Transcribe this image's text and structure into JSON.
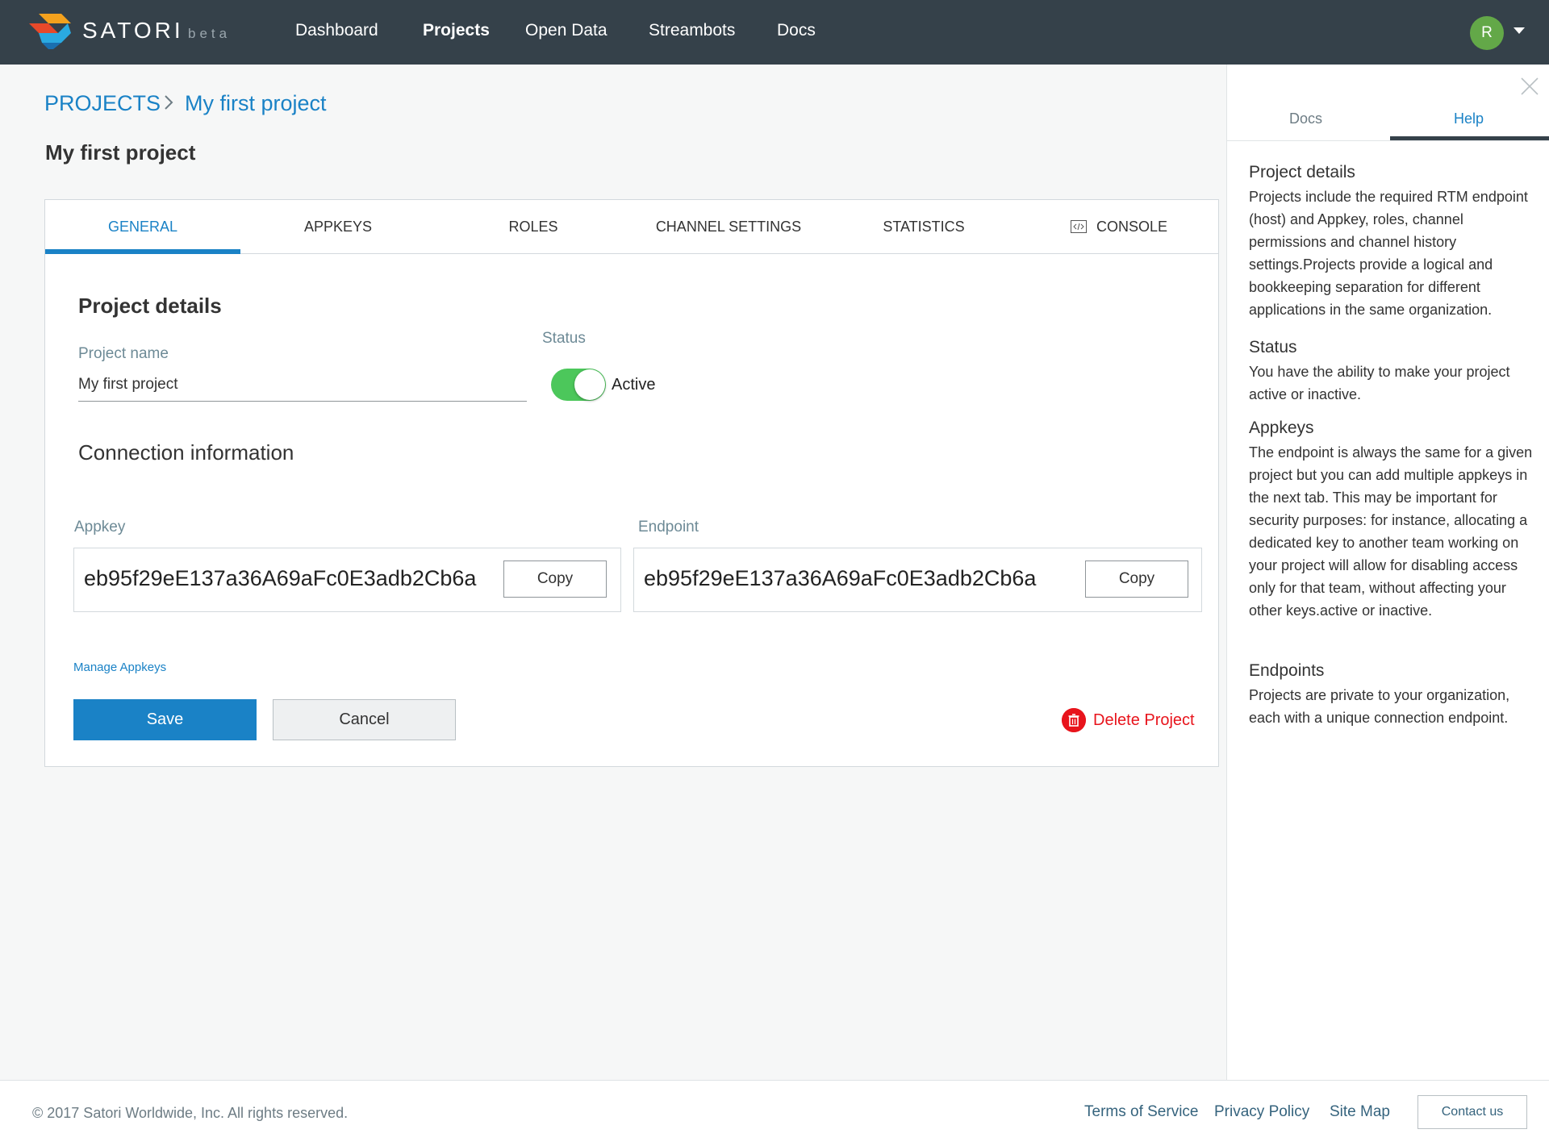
{
  "brand": {
    "name": "SATORI",
    "tag": "beta"
  },
  "nav": {
    "items": [
      {
        "label": "Dashboard"
      },
      {
        "label": "Projects"
      },
      {
        "label": "Open Data"
      },
      {
        "label": "Streambots"
      },
      {
        "label": "Docs"
      }
    ],
    "active": "Projects",
    "avatar_initial": "R"
  },
  "breadcrumb": {
    "root": "PROJECTS",
    "current": "My first project"
  },
  "page_title": "My first project",
  "tabs": [
    {
      "label": "GENERAL"
    },
    {
      "label": "APPKEYS"
    },
    {
      "label": "ROLES"
    },
    {
      "label": "CHANNEL SETTINGS"
    },
    {
      "label": "STATISTICS"
    },
    {
      "label": "CONSOLE"
    }
  ],
  "active_tab": "GENERAL",
  "project_details": {
    "heading": "Project details",
    "name_label": "Project name",
    "name_value": "My first project",
    "status_label": "Status",
    "status_value": "Active",
    "status_on": true
  },
  "connection": {
    "heading": "Connection information",
    "appkey_label": "Appkey",
    "appkey_value": "eb95f29eE137a36A69aFc0E3adb2Cb6a",
    "endpoint_label": "Endpoint",
    "endpoint_value": "eb95f29eE137a36A69aFc0E3adb2Cb6a",
    "copy_label": "Copy"
  },
  "actions": {
    "manage_appkeys": "Manage Appkeys",
    "save": "Save",
    "cancel": "Cancel",
    "delete": "Delete Project"
  },
  "help_panel": {
    "tabs": [
      {
        "label": "Docs"
      },
      {
        "label": "Help"
      }
    ],
    "active_tab": "Help",
    "sections": [
      {
        "title": "Project details",
        "body": "Projects include the required RTM endpoint (host) and Appkey, roles, channel permissions and channel history settings.Projects provide a logical and bookkeeping separation for different applications in the same organization."
      },
      {
        "title": "Status",
        "body": "You have the ability to make your project active or inactive."
      },
      {
        "title": "Appkeys",
        "body": "The endpoint is always the same for a given project but you can add multiple appkeys in the next tab. This may be important for security purposes: for instance, allocating a dedicated key to another team working on your project will allow for disabling access only for that team, without affecting your other keys.active or inactive."
      },
      {
        "title": "Endpoints",
        "body": "Projects are private to your organization, each with a unique connection endpoint."
      }
    ]
  },
  "footer": {
    "copyright": "© 2017 Satori Worldwide, Inc. All rights reserved.",
    "links": [
      {
        "label": "Terms of Service"
      },
      {
        "label": "Privacy Policy"
      },
      {
        "label": "Site Map"
      }
    ],
    "contact": "Contact us"
  },
  "colors": {
    "nav_bg": "#35414a",
    "accent": "#1a82c6",
    "toggle_on": "#4cc75b",
    "danger": "#e8141c",
    "avatar": "#63a848"
  }
}
